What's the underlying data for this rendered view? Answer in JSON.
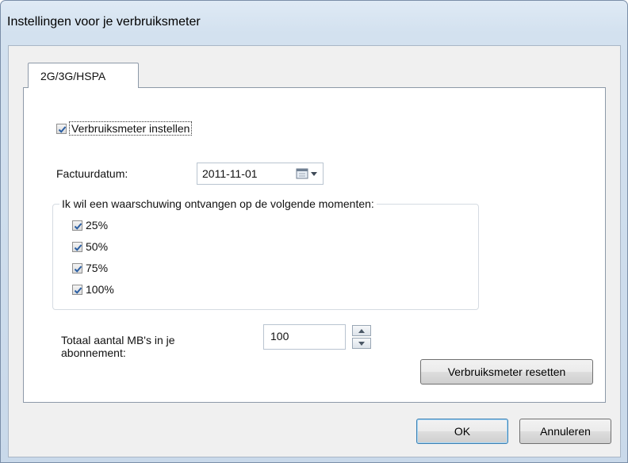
{
  "window": {
    "title": "Instellingen voor je verbruiksmeter"
  },
  "tabs": [
    {
      "label": "2G/3G/HSPA",
      "active": true
    }
  ],
  "enable": {
    "label": "Verbruiksmeter instellen",
    "checked": true
  },
  "billing": {
    "label": "Factuurdatum:",
    "date": "2011-11-01"
  },
  "warnings": {
    "legend": "Ik wil een waarschuwing ontvangen op de volgende momenten:",
    "options": [
      {
        "label": "25%",
        "checked": true
      },
      {
        "label": "50%",
        "checked": true
      },
      {
        "label": "75%",
        "checked": true
      },
      {
        "label": "100%",
        "checked": true
      }
    ]
  },
  "total_mb": {
    "label_line1": "Totaal aantal MB's in je",
    "label_line2": "abonnement:",
    "value": "100"
  },
  "buttons": {
    "reset": "Verbruiksmeter resetten",
    "ok": "OK",
    "cancel": "Annuleren"
  },
  "colors": {
    "check": "#2b5fa3",
    "accent": "#3c7fb1"
  }
}
